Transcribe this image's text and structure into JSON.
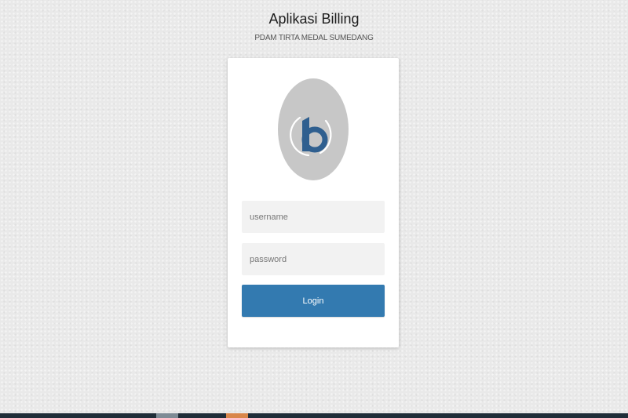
{
  "header": {
    "title": "Aplikasi Billing",
    "subtitle": "PDAM TIRTA MEDAL SUMEDANG"
  },
  "logo": {
    "icon": "billing-b-logo-icon",
    "letter": "b",
    "circle_color": "#c7c7c7",
    "letter_color": "#2f5f8f"
  },
  "form": {
    "username": {
      "value": "",
      "placeholder": "username"
    },
    "password": {
      "value": "",
      "placeholder": "password"
    },
    "login_label": "Login"
  },
  "colors": {
    "background": "#e9e9e9",
    "card": "#ffffff",
    "input_background": "#f2f2f2",
    "primary_button": "#337ab0",
    "footer_bar": "#1f2d38"
  }
}
